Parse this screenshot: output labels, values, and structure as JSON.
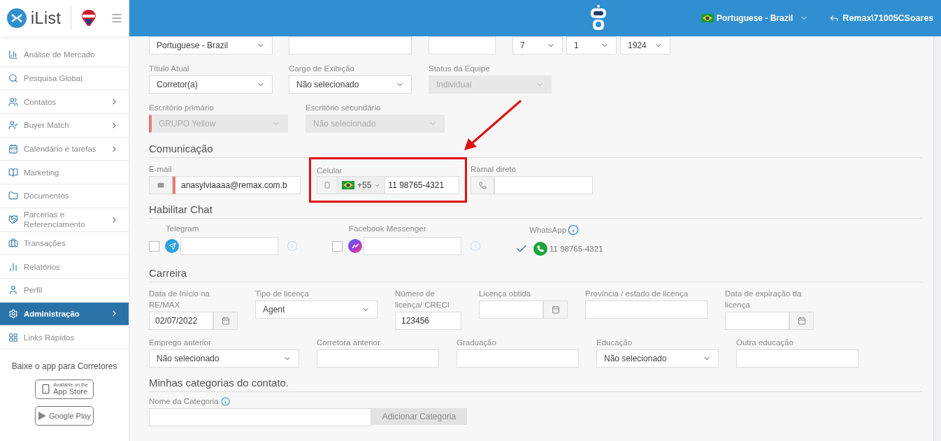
{
  "sidebar": {
    "logo": "iList",
    "items": [
      {
        "label": "Análise de Mercado",
        "expandable": false,
        "selected": false
      },
      {
        "label": "Pesquisa Global",
        "expandable": false,
        "selected": false
      },
      {
        "label": "Contatos",
        "expandable": true,
        "selected": false
      },
      {
        "label": "Buyer Match",
        "expandable": true,
        "selected": false
      },
      {
        "label": "Calendário e tarefas",
        "expandable": true,
        "selected": false
      },
      {
        "label": "Marketing",
        "expandable": false,
        "selected": false
      },
      {
        "label": "Documentos",
        "expandable": false,
        "selected": false
      },
      {
        "label": "Parcerias e Referenciamento",
        "expandable": true,
        "selected": false
      },
      {
        "label": "Transações",
        "expandable": false,
        "selected": false
      },
      {
        "label": "Relatórios",
        "expandable": false,
        "selected": false
      },
      {
        "label": "Perfil",
        "expandable": false,
        "selected": false
      },
      {
        "label": "Administração",
        "expandable": true,
        "selected": true
      },
      {
        "label": "Links Rápidos",
        "expandable": false,
        "selected": false
      }
    ],
    "app_promo": "Baixe o app para Corretores",
    "badges": [
      {
        "small": "Available on the",
        "big": "App Store"
      },
      {
        "big": "Google Play"
      }
    ]
  },
  "header": {
    "language": "Portuguese - Brazil",
    "user": "Remax\\71005CSoares"
  },
  "form": {
    "top_row": {
      "fields": [
        {
          "kind": "select",
          "value": "Portuguese - Brazil",
          "disabled": false,
          "required": false
        },
        {
          "kind": "input",
          "disabled": false,
          "required": false
        },
        {
          "kind": "input",
          "disabled": false,
          "required": false
        },
        {
          "kind": "select",
          "value": "7",
          "disabled": false,
          "required": false
        },
        {
          "kind": "select",
          "value": "1",
          "disabled": false,
          "required": false
        },
        {
          "kind": "select",
          "value": "1924",
          "disabled": false,
          "required": false
        }
      ]
    },
    "rows": [
      {
        "fields": [
          {
            "kind": "select",
            "label": "Título Atual",
            "value": "Corretor(a)",
            "disabled": false,
            "required": false
          },
          {
            "kind": "select",
            "label": "Cargo de Exibição",
            "value": "Não selecionado",
            "disabled": false,
            "required": false
          },
          {
            "kind": "select",
            "label": "Status da Equipe",
            "value": "Individual",
            "disabled": true,
            "required": false
          }
        ]
      },
      {
        "fields": [
          {
            "kind": "select",
            "label": "Escritório primário",
            "value": "GRUPO Yellow",
            "disabled": true,
            "required": true
          },
          {
            "kind": "select",
            "label": "Escritório secundário",
            "value": "Não selecionado",
            "disabled": true,
            "required": false
          }
        ]
      }
    ],
    "sections": [
      {
        "kind": "fields",
        "title": "Comunicação",
        "rows": [
          {
            "fields": [
              {
                "kind": "email",
                "label": "E-mail",
                "value": "anasylviaaaa@remax.com.b",
                "disabled": false,
                "required": true
              },
              {
                "kind": "phone",
                "label": "Celular",
                "country_code": "+55",
                "value": "11 98765-4321",
                "disabled": false,
                "required": false,
                "highlighted": true
              },
              {
                "kind": "extension",
                "label": "Ramal direto",
                "disabled": false,
                "required": false
              }
            ]
          }
        ]
      },
      {
        "kind": "chat",
        "title": "Habilitar Chat",
        "chats": [
          {
            "label": "Telegram",
            "checked": false
          },
          {
            "label": "Facebook Messenger",
            "checked": false
          },
          {
            "label": "WhatsApp",
            "checked": true,
            "value": "11 98765-4321"
          }
        ]
      },
      {
        "kind": "fields",
        "title": "Carreira",
        "rows": [
          {
            "fields": [
              {
                "kind": "date",
                "label": "Data de Início na RE/MAX",
                "value": "02/07/2022",
                "disabled": false,
                "required": false
              },
              {
                "kind": "select",
                "label": "Tipo de licença",
                "value": "Agent",
                "disabled": false,
                "required": false
              },
              {
                "kind": "input",
                "label": "Número de licença/ CRECI",
                "value": "123456",
                "disabled": false,
                "required": false
              },
              {
                "kind": "date",
                "label": "Licença obtida",
                "disabled": false,
                "required": false
              },
              {
                "kind": "input",
                "label": "Província / estado de licença",
                "disabled": false,
                "required": false
              },
              {
                "kind": "date",
                "label": "Data de expiração da licença",
                "disabled": false,
                "required": false
              }
            ]
          },
          {
            "fields": [
              {
                "kind": "select",
                "label": "Emprego anterior",
                "value": "Não selecionado",
                "disabled": false,
                "required": false
              },
              {
                "kind": "input",
                "label": "Corretora anterior",
                "disabled": false,
                "required": false
              },
              {
                "kind": "input",
                "label": "Graduação",
                "disabled": false,
                "required": false
              },
              {
                "kind": "select",
                "label": "Educação",
                "value": "Não selecionado",
                "disabled": false,
                "required": false
              },
              {
                "kind": "input",
                "label": "Outra educação",
                "disabled": false,
                "required": false
              }
            ]
          }
        ]
      },
      {
        "kind": "category",
        "title": "Minhas categorias do contato.",
        "label": "Nome da Categoria",
        "button": "Adicionar Categoria"
      }
    ]
  }
}
